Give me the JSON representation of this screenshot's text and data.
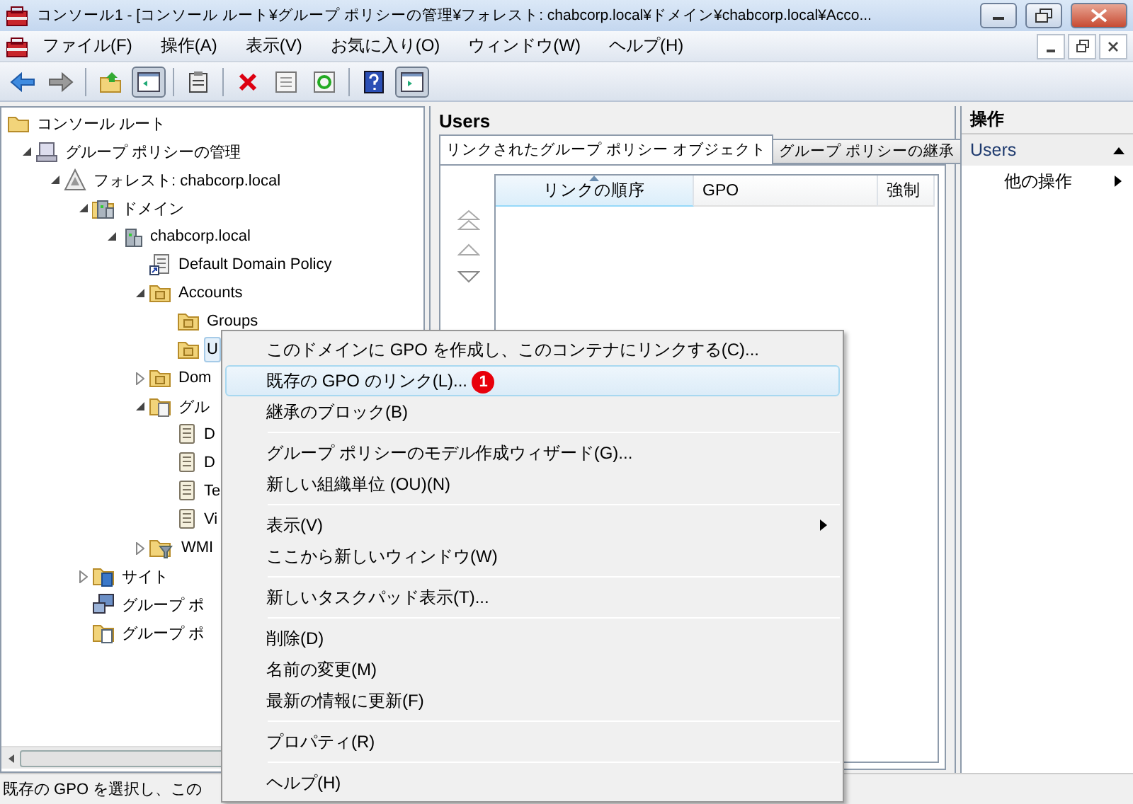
{
  "window": {
    "title": "コンソール1 - [コンソール ルート¥グループ ポリシーの管理¥フォレスト: chabcorp.local¥ドメイン¥chabcorp.local¥Acco..."
  },
  "menu_bar": [
    "ファイル(F)",
    "操作(A)",
    "表示(V)",
    "お気に入り(O)",
    "ウィンドウ(W)",
    "ヘルプ(H)"
  ],
  "toolbar": [
    {
      "kind": "back",
      "pressed": false
    },
    {
      "kind": "forward",
      "pressed": false
    },
    {
      "kind": "separator"
    },
    {
      "kind": "up",
      "pressed": false
    },
    {
      "kind": "tree",
      "pressed": true
    },
    {
      "kind": "separator"
    },
    {
      "kind": "clipboard",
      "pressed": false
    },
    {
      "kind": "separator"
    },
    {
      "kind": "delete",
      "pressed": false
    },
    {
      "kind": "properties",
      "pressed": false
    },
    {
      "kind": "refresh",
      "pressed": false
    },
    {
      "kind": "separator"
    },
    {
      "kind": "help",
      "pressed": false
    },
    {
      "kind": "pane",
      "pressed": true
    }
  ],
  "tree": [
    {
      "label": "コンソール ルート",
      "kind": "folder",
      "selected": false,
      "children": [
        {
          "label": "グループ ポリシーの管理",
          "kind": "gpm",
          "expanded": true,
          "selected": false,
          "children": [
            {
              "label": "フォレスト: chabcorp.local",
              "kind": "forest",
              "expanded": true,
              "selected": false,
              "children": [
                {
                  "label": "ドメイン",
                  "kind": "domains",
                  "expanded": true,
                  "selected": false,
                  "children": [
                    {
                      "label": "chabcorp.local",
                      "kind": "domain",
                      "expanded": true,
                      "selected": false,
                      "children": [
                        {
                          "label": "Default Domain Policy",
                          "kind": "link",
                          "selected": false
                        },
                        {
                          "label": "Accounts",
                          "kind": "ou",
                          "expanded": true,
                          "selected": false,
                          "children": [
                            {
                              "label": "Groups",
                              "kind": "ou",
                              "selected": false
                            },
                            {
                              "label": "U",
                              "kind": "ou",
                              "selected": true
                            }
                          ]
                        },
                        {
                          "label": "Dom",
                          "kind": "ou",
                          "expanded": false,
                          "selected": false
                        },
                        {
                          "label": "グル",
                          "kind": "gpofolder",
                          "expanded": true,
                          "selected": false,
                          "children": [
                            {
                              "label": "D",
                              "kind": "gpo",
                              "selected": false
                            },
                            {
                              "label": "D",
                              "kind": "gpo",
                              "selected": false
                            },
                            {
                              "label": "Te",
                              "kind": "gpo",
                              "selected": false
                            },
                            {
                              "label": "Vi",
                              "kind": "gpo",
                              "selected": false
                            }
                          ]
                        },
                        {
                          "label": "WMI",
                          "kind": "wmi",
                          "expanded": false,
                          "selected": false
                        }
                      ]
                    }
                  ]
                },
                {
                  "label": "サイト",
                  "kind": "sites",
                  "expanded": false,
                  "selected": false
                },
                {
                  "label": "グループ ポ",
                  "kind": "modeling",
                  "selected": false
                },
                {
                  "label": "グループ ポ",
                  "kind": "results",
                  "selected": false
                }
              ]
            }
          ]
        }
      ]
    }
  ],
  "content": {
    "title": "Users",
    "tabs": [
      {
        "label": "リンクされたグループ ポリシー オブジェクト",
        "selected": true
      },
      {
        "label": "グループ ポリシーの継承",
        "selected": false
      }
    ],
    "columns": [
      {
        "label": "リンクの順序",
        "sorted": true
      },
      {
        "label": "GPO",
        "sorted": false
      },
      {
        "label": "強制",
        "sorted": false
      }
    ]
  },
  "actions": {
    "title": "操作",
    "section": "Users",
    "items": [
      {
        "label": "他の操作"
      }
    ]
  },
  "context_menu": {
    "groups": [
      [
        {
          "label": "このドメインに GPO を作成し、このコンテナにリンクする(C)...",
          "selected": false,
          "submenu": false
        },
        {
          "label": "既存の GPO のリンク(L)...",
          "selected": true,
          "submenu": false,
          "badge": "1"
        },
        {
          "label": "継承のブロック(B)",
          "selected": false,
          "submenu": false
        }
      ],
      [
        {
          "label": "グループ ポリシーのモデル作成ウィザード(G)...",
          "selected": false,
          "submenu": false
        },
        {
          "label": "新しい組織単位 (OU)(N)",
          "selected": false,
          "submenu": false
        }
      ],
      [
        {
          "label": "表示(V)",
          "selected": false,
          "submenu": true
        },
        {
          "label": "ここから新しいウィンドウ(W)",
          "selected": false,
          "submenu": false
        }
      ],
      [
        {
          "label": "新しいタスクパッド表示(T)...",
          "selected": false,
          "submenu": false
        }
      ],
      [
        {
          "label": "削除(D)",
          "selected": false,
          "submenu": false
        },
        {
          "label": "名前の変更(M)",
          "selected": false,
          "submenu": false
        },
        {
          "label": "最新の情報に更新(F)",
          "selected": false,
          "submenu": false
        }
      ],
      [
        {
          "label": "プロパティ(R)",
          "selected": false,
          "submenu": false
        }
      ],
      [
        {
          "label": "ヘルプ(H)",
          "selected": false,
          "submenu": false
        }
      ]
    ]
  },
  "status_bar": "既存の GPO を選択し、この"
}
